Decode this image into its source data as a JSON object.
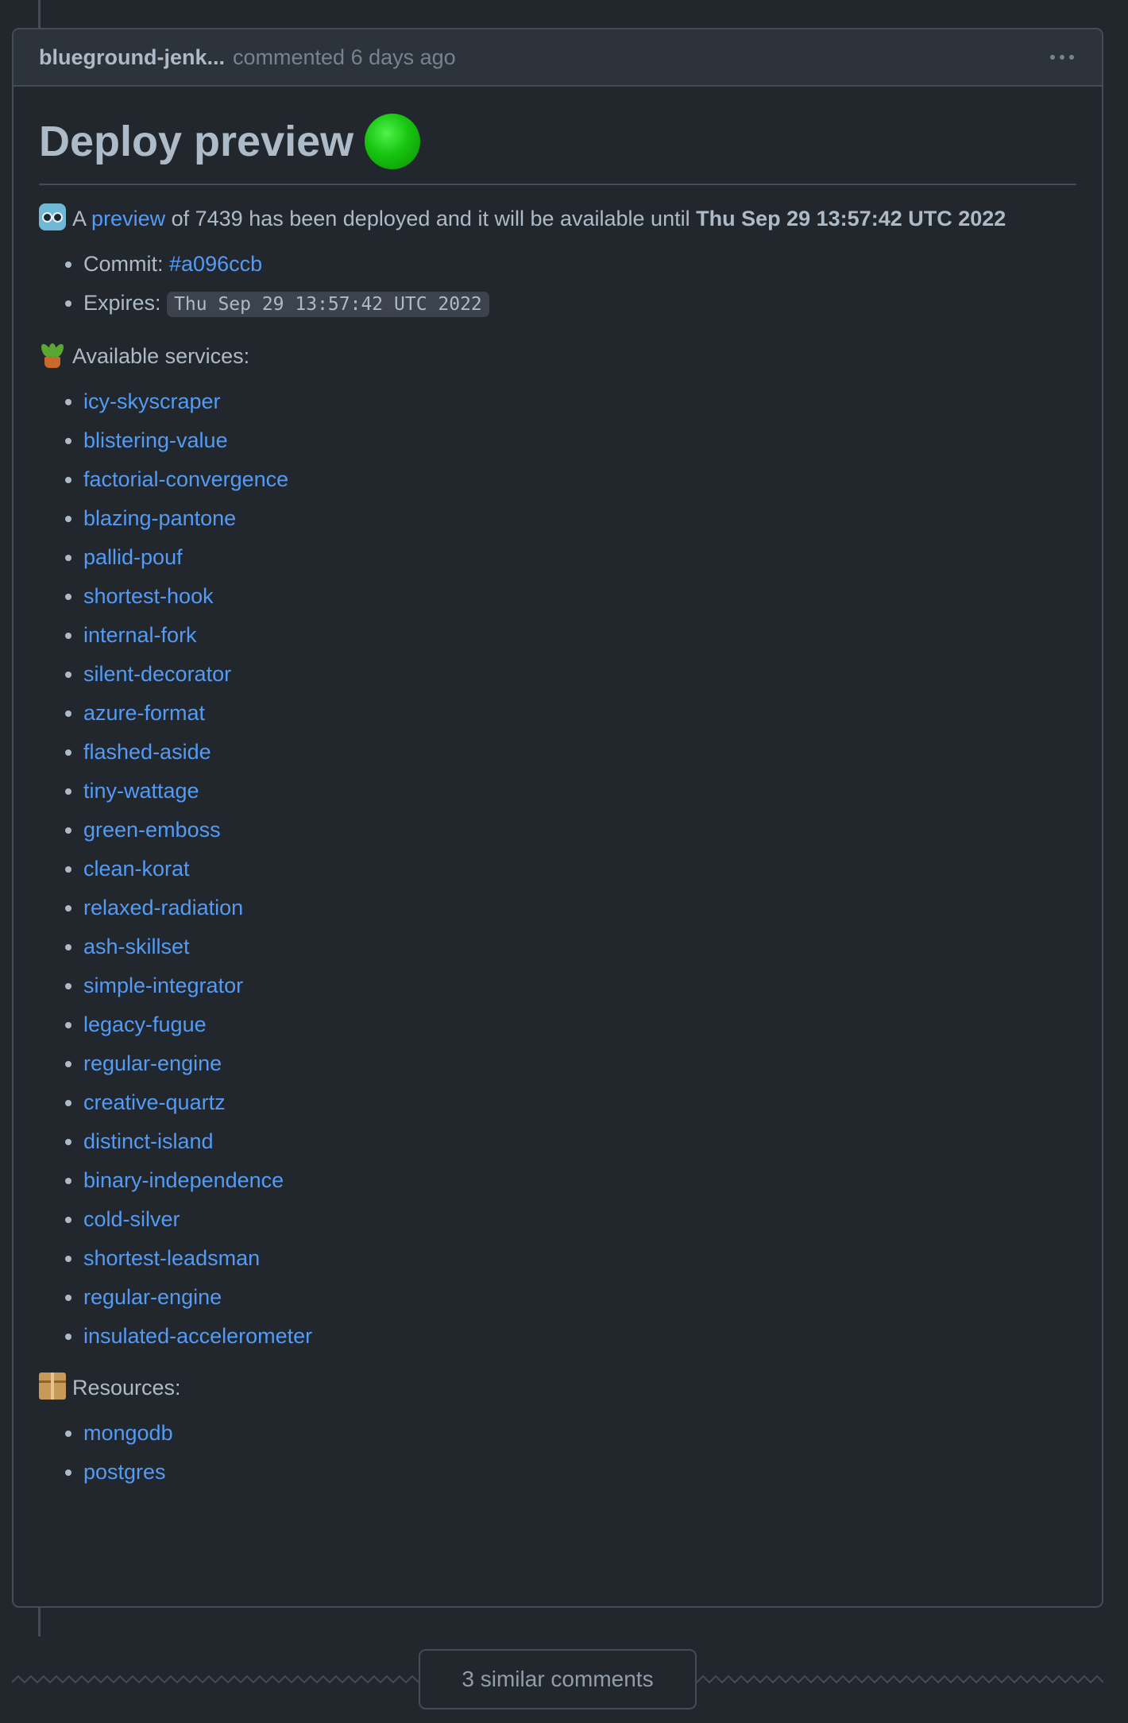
{
  "comment": {
    "author": "blueground-jenk...",
    "meta": "commented 6 days ago",
    "title": "Deploy preview",
    "intro": {
      "prefix": "A",
      "link": "preview",
      "middle": "of 7439 has been deployed and it will be available until",
      "until": "Thu Sep 29 13:57:42 UTC 2022"
    },
    "commit_label": "Commit:",
    "commit": "#a096ccb",
    "expires_label": "Expires:",
    "expires": "Thu Sep 29 13:57:42 UTC 2022",
    "services_label": "Available services:",
    "services": [
      "icy-skyscraper",
      "blistering-value",
      "factorial-convergence",
      "blazing-pantone",
      "pallid-pouf",
      "shortest-hook",
      "internal-fork",
      "silent-decorator",
      "azure-format",
      "flashed-aside",
      "tiny-wattage",
      "green-emboss",
      "clean-korat",
      "relaxed-radiation",
      "ash-skillset",
      "simple-integrator",
      "legacy-fugue",
      "regular-engine",
      "creative-quartz",
      "distinct-island",
      "binary-independence",
      "cold-silver",
      "shortest-leadsman",
      "regular-engine",
      "insulated-accelerometer"
    ],
    "resources_label": "Resources:",
    "resources": [
      "mongodb",
      "postgres"
    ]
  },
  "similar_comments": "3 similar comments",
  "icons": {
    "title_icon": "green-circle-icon",
    "intro_icon": "robot-icon",
    "services_icon": "potted-plant-icon",
    "resources_icon": "package-icon",
    "menu_icon": "kebab-menu-icon"
  },
  "colors": {
    "background": "#22272e",
    "header": "#2d333b",
    "border": "#444c56",
    "link": "#539bf5",
    "text": "#adbac7",
    "muted": "#768390"
  }
}
